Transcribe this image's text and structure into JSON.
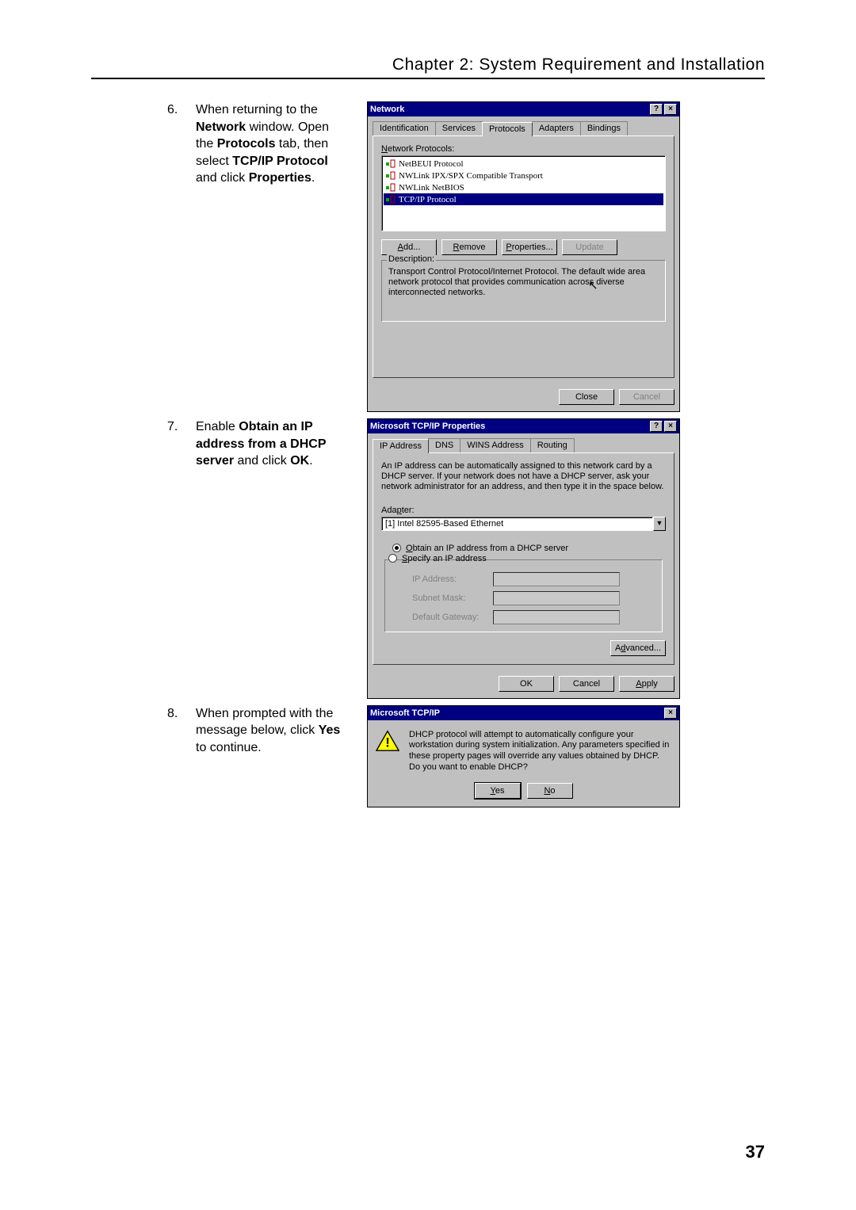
{
  "chapter_header": "Chapter 2: System Requirement and Installation",
  "page_number": "37",
  "steps": {
    "s6": {
      "num": "6.",
      "text_parts": [
        "When returning to the ",
        "Network",
        " window. Open the ",
        "Protocols",
        " tab, then select ",
        "TCP/IP Protocol",
        " and click ",
        "Properties",
        "."
      ]
    },
    "s7": {
      "num": "7.",
      "text_parts": [
        "Enable ",
        "Obtain an IP address from a DHCP server",
        " and click ",
        "OK",
        "."
      ]
    },
    "s8": {
      "num": "8.",
      "text_parts": [
        "When prompted with the message below, click ",
        "Yes",
        " to continue."
      ]
    }
  },
  "dialog1": {
    "title": "Network",
    "tabs": [
      "Identification",
      "Services",
      "Protocols",
      "Adapters",
      "Bindings"
    ],
    "list_label": "Network Protocols:",
    "items": [
      "NetBEUI Protocol",
      "NWLink IPX/SPX Compatible Transport",
      "NWLink NetBIOS",
      "TCP/IP Protocol"
    ],
    "buttons": {
      "add": "Add...",
      "remove": "Remove",
      "properties": "Properties...",
      "update": "Update"
    },
    "desc_label": "Description:",
    "desc_text": "Transport Control Protocol/Internet Protocol. The default wide area network protocol that provides communication across diverse interconnected networks.",
    "close": "Close",
    "cancel": "Cancel"
  },
  "dialog2": {
    "title": "Microsoft TCP/IP Properties",
    "tabs": [
      "IP Address",
      "DNS",
      "WINS Address",
      "Routing"
    ],
    "intro": "An IP address can be automatically assigned to this network card by a DHCP server. If your network does not have a DHCP server, ask your network administrator for an address, and then type it in the space below.",
    "adapter_label": "Adapter:",
    "adapter_value": "[1] Intel 82595-Based Ethernet",
    "opt_obtain": "Obtain an IP address from a DHCP server",
    "opt_specify": "Specify an IP address",
    "ip_label": "IP Address:",
    "subnet_label": "Subnet Mask:",
    "gateway_label": "Default Gateway:",
    "advanced": "Advanced...",
    "ok": "OK",
    "cancel": "Cancel",
    "apply": "Apply"
  },
  "dialog3": {
    "title": "Microsoft TCP/IP",
    "message": "DHCP protocol will attempt to automatically configure your workstation during system initialization. Any parameters specified in these property pages will override any values obtained by DHCP. Do you want to enable DHCP?",
    "yes": "Yes",
    "no": "No"
  }
}
